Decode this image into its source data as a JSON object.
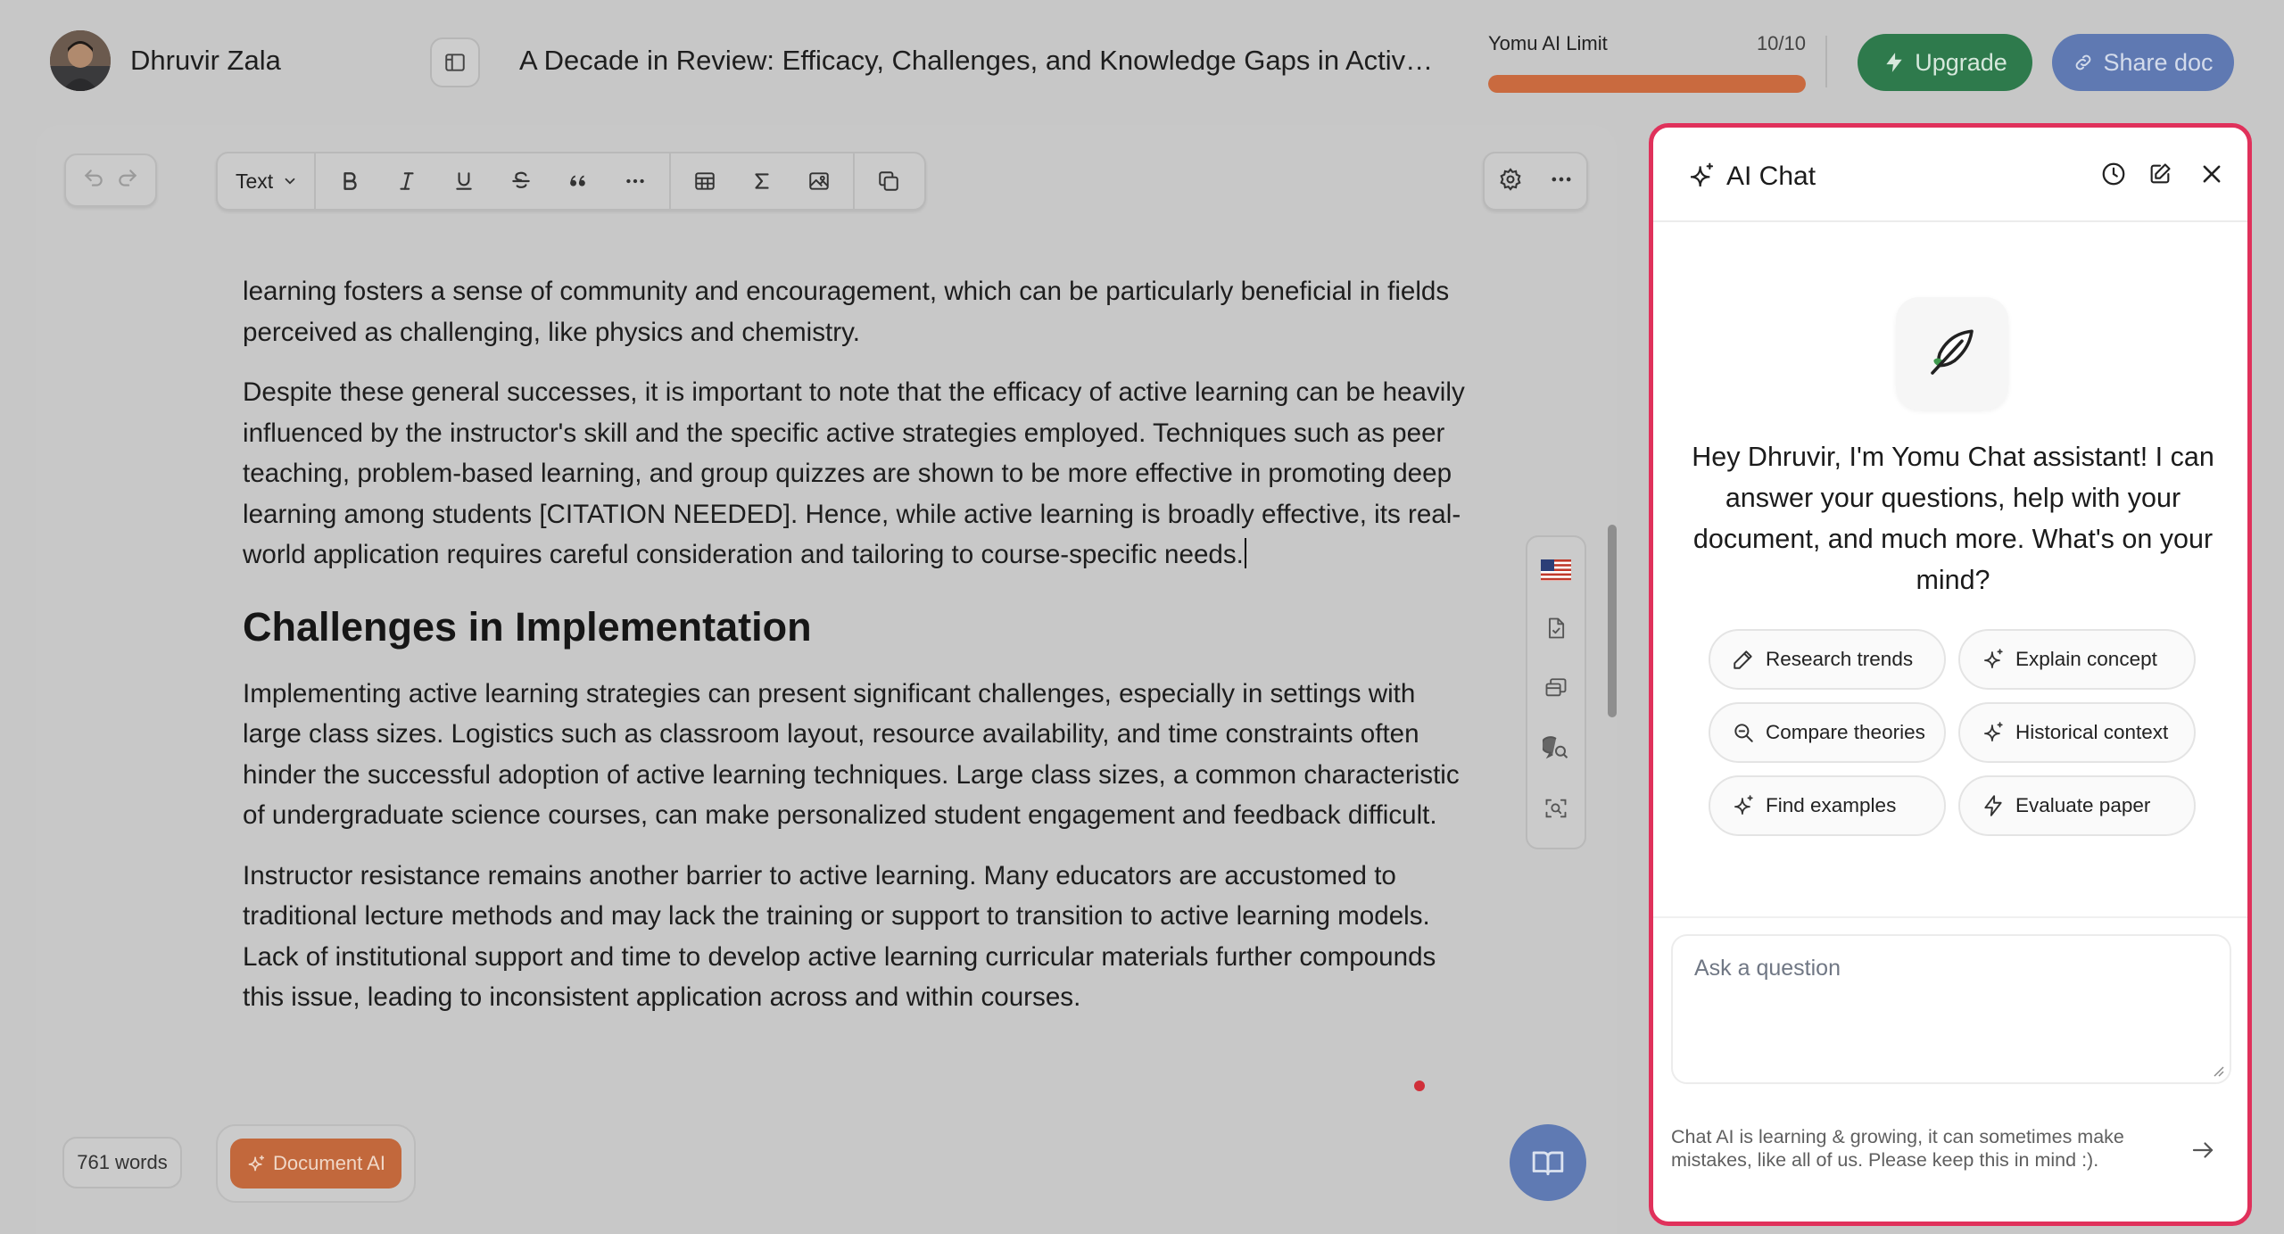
{
  "header": {
    "user_name": "Dhruvir Zala",
    "doc_title": "A Decade in Review: Efficacy, Challenges, and Knowledge Gaps in Active L...",
    "ai_limit": {
      "label": "Yomu AI Limit",
      "count": "10/10",
      "used_fraction": 1.0,
      "bar_color": "#c96a3f"
    },
    "upgrade_label": "Upgrade",
    "share_label": "Share doc",
    "colors": {
      "upgrade": "#2e7a4c",
      "share": "#5f79b2"
    }
  },
  "toolbar": {
    "text_style": "Text",
    "buttons": [
      "undo-icon",
      "redo-icon",
      "bold-icon",
      "italic-icon",
      "underline-icon",
      "strikethrough-icon",
      "quote-icon",
      "more-icon",
      "table-icon",
      "sigma-icon",
      "image-icon",
      "copy-icon",
      "gear-icon",
      "more-icon"
    ]
  },
  "document": {
    "paragraphs_before": [
      "learning fosters a sense of community and encouragement, which can be particularly beneficial in fields perceived as challenging, like physics and chemistry.",
      "Despite these general successes, it is important to note that the efficacy of active learning can be heavily influenced by the instructor's skill and the specific active strategies employed. Techniques such as peer teaching, problem-based learning, and group quizzes are shown to be more effective in promoting deep learning among students [CITATION NEEDED]. Hence, while active learning is broadly effective, its real-world application requires careful consideration and tailoring to course-specific needs."
    ],
    "heading": "Challenges in Implementation",
    "paragraphs_after": [
      "Implementing active learning strategies can present significant challenges, especially in settings with large class sizes. Logistics such as classroom layout, resource availability, and time constraints often hinder the successful adoption of active learning techniques. Large class sizes, a common characteristic of undergraduate science courses, can make personalized student engagement and feedback difficult.",
      "Instructor resistance remains another barrier to active learning. Many educators are accustomed to traditional lecture methods and may lack the training or support to transition to active learning models. Lack of institutional support and time to develop active learning curricular materials further compounds this issue, leading to inconsistent application across and within courses."
    ],
    "word_count": "761 words",
    "document_ai_label": "Document AI",
    "side_tools": [
      "us-flag-icon",
      "document-check-icon",
      "stack-icon",
      "chat-search-icon",
      "scan-icon"
    ]
  },
  "chat": {
    "title": "AI Chat",
    "greeting": "Hey Dhruvir, I'm Yomu Chat assistant! I can answer your questions, help with your document, and much more. What's on your mind?",
    "suggestions": [
      {
        "label": "Research trends",
        "icon": "pencil-icon"
      },
      {
        "label": "Explain concept",
        "icon": "sparkle-icon"
      },
      {
        "label": "Compare theories",
        "icon": "search-icon"
      },
      {
        "label": "Historical context",
        "icon": "sparkle-icon"
      },
      {
        "label": "Find examples",
        "icon": "sparkle-icon"
      },
      {
        "label": "Evaluate paper",
        "icon": "bolt-icon"
      }
    ],
    "input_placeholder": "Ask a question",
    "disclaimer": "Chat AI is learning & growing, it can sometimes make mistakes, like all of us. Please keep this in mind :).",
    "accent_color": "#e0315b"
  }
}
